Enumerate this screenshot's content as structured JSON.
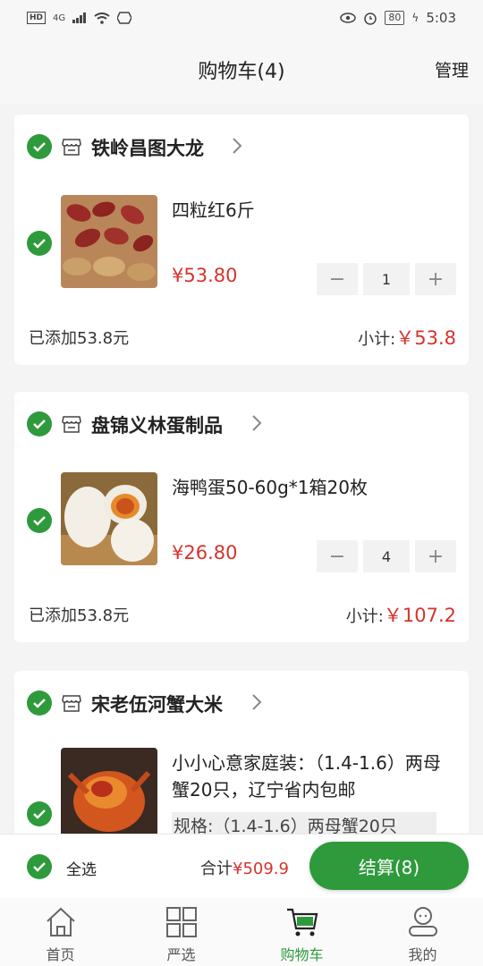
{
  "status_bar": {
    "hd": "HD",
    "network": "4G",
    "battery": "80",
    "time": "5:03"
  },
  "header": {
    "title": "购物车(4)",
    "manage": "管理"
  },
  "shops": [
    {
      "name": "铁岭昌图大龙",
      "item_title": "四粒红6斤",
      "price": "¥53.80",
      "quantity": "1",
      "added": "已添加53.8元",
      "subtotal_label": "小计:",
      "subtotal_value": "￥53.8"
    },
    {
      "name": "盘锦义林蛋制品",
      "item_title": "海鸭蛋50-60g*1箱20枚",
      "price": "¥26.80",
      "quantity": "4",
      "added": "已添加53.8元",
      "subtotal_label": "小计:",
      "subtotal_value": "￥107.2"
    },
    {
      "name": "宋老伍河蟹大米",
      "item_title": "小小心意家庭装：（1.4-1.6）两母蟹20只，辽宁省内包邮",
      "spec": "规格:（1.4-1.6）两母蟹20只"
    }
  ],
  "stepper": {
    "minus": "−",
    "plus": "+"
  },
  "bottom_bar": {
    "select_all": "全选",
    "total_label": "合计",
    "total_value": "¥509.9",
    "checkout": "结算(8)"
  },
  "tabs": [
    {
      "label": "首页",
      "icon": "home-icon"
    },
    {
      "label": "严选",
      "icon": "grid-icon"
    },
    {
      "label": "购物车",
      "icon": "cart-icon"
    },
    {
      "label": "我的",
      "icon": "profile-icon"
    }
  ],
  "colors": {
    "accent": "#2e9a3c",
    "price": "#d5342c"
  }
}
